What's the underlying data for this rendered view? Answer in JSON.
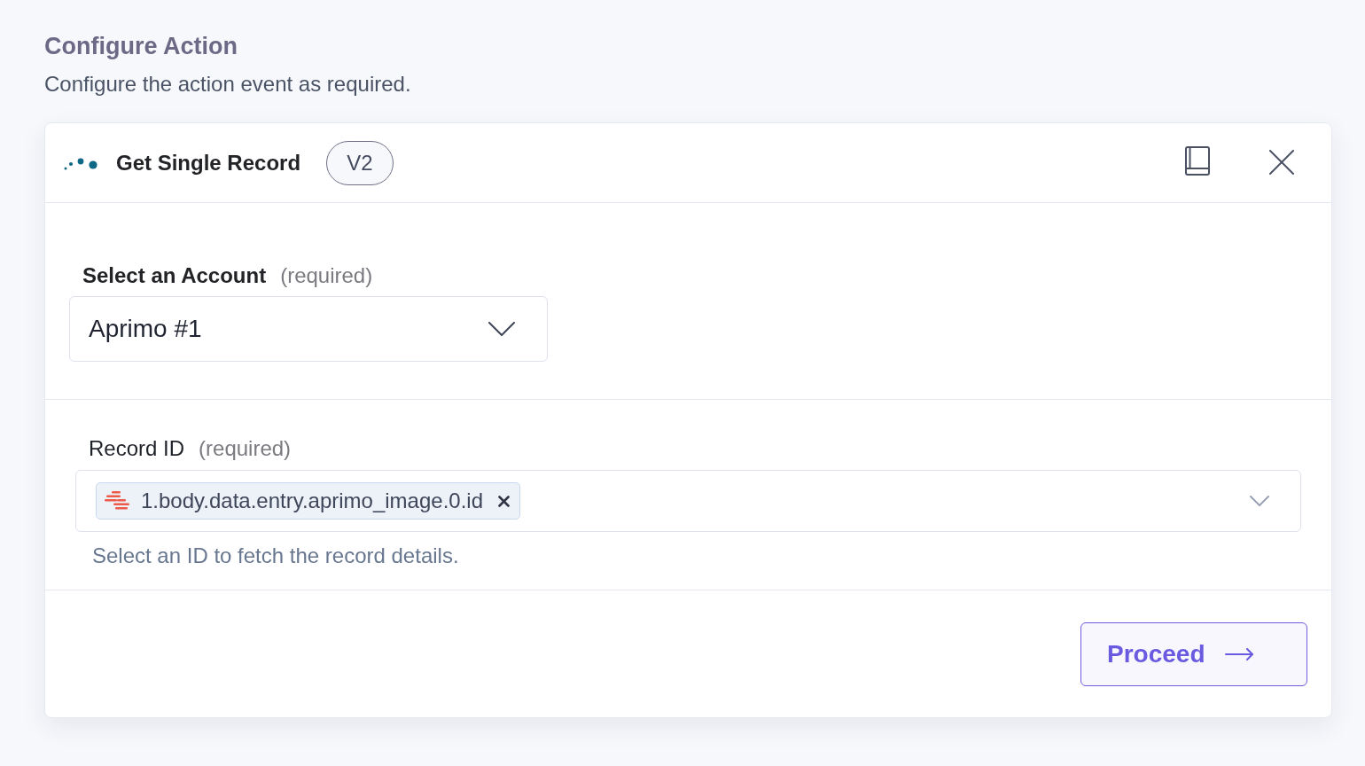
{
  "page": {
    "title": "Configure Action",
    "subtitle": "Configure the action event as required."
  },
  "card": {
    "title": "Get Single Record",
    "version": "V2"
  },
  "fields": [
    {
      "kind": "select",
      "label": "Select an Account",
      "qualifier": "(required)",
      "value": "Aprimo #1"
    },
    {
      "kind": "tag_select",
      "label": "Record ID",
      "qualifier": "(required)",
      "tags": [
        {
          "text": "1.body.data.entry.aprimo_image.0.id"
        }
      ],
      "help": "Select an ID to fetch the record details."
    }
  ],
  "actions": [
    {
      "label": "Proceed"
    }
  ]
}
